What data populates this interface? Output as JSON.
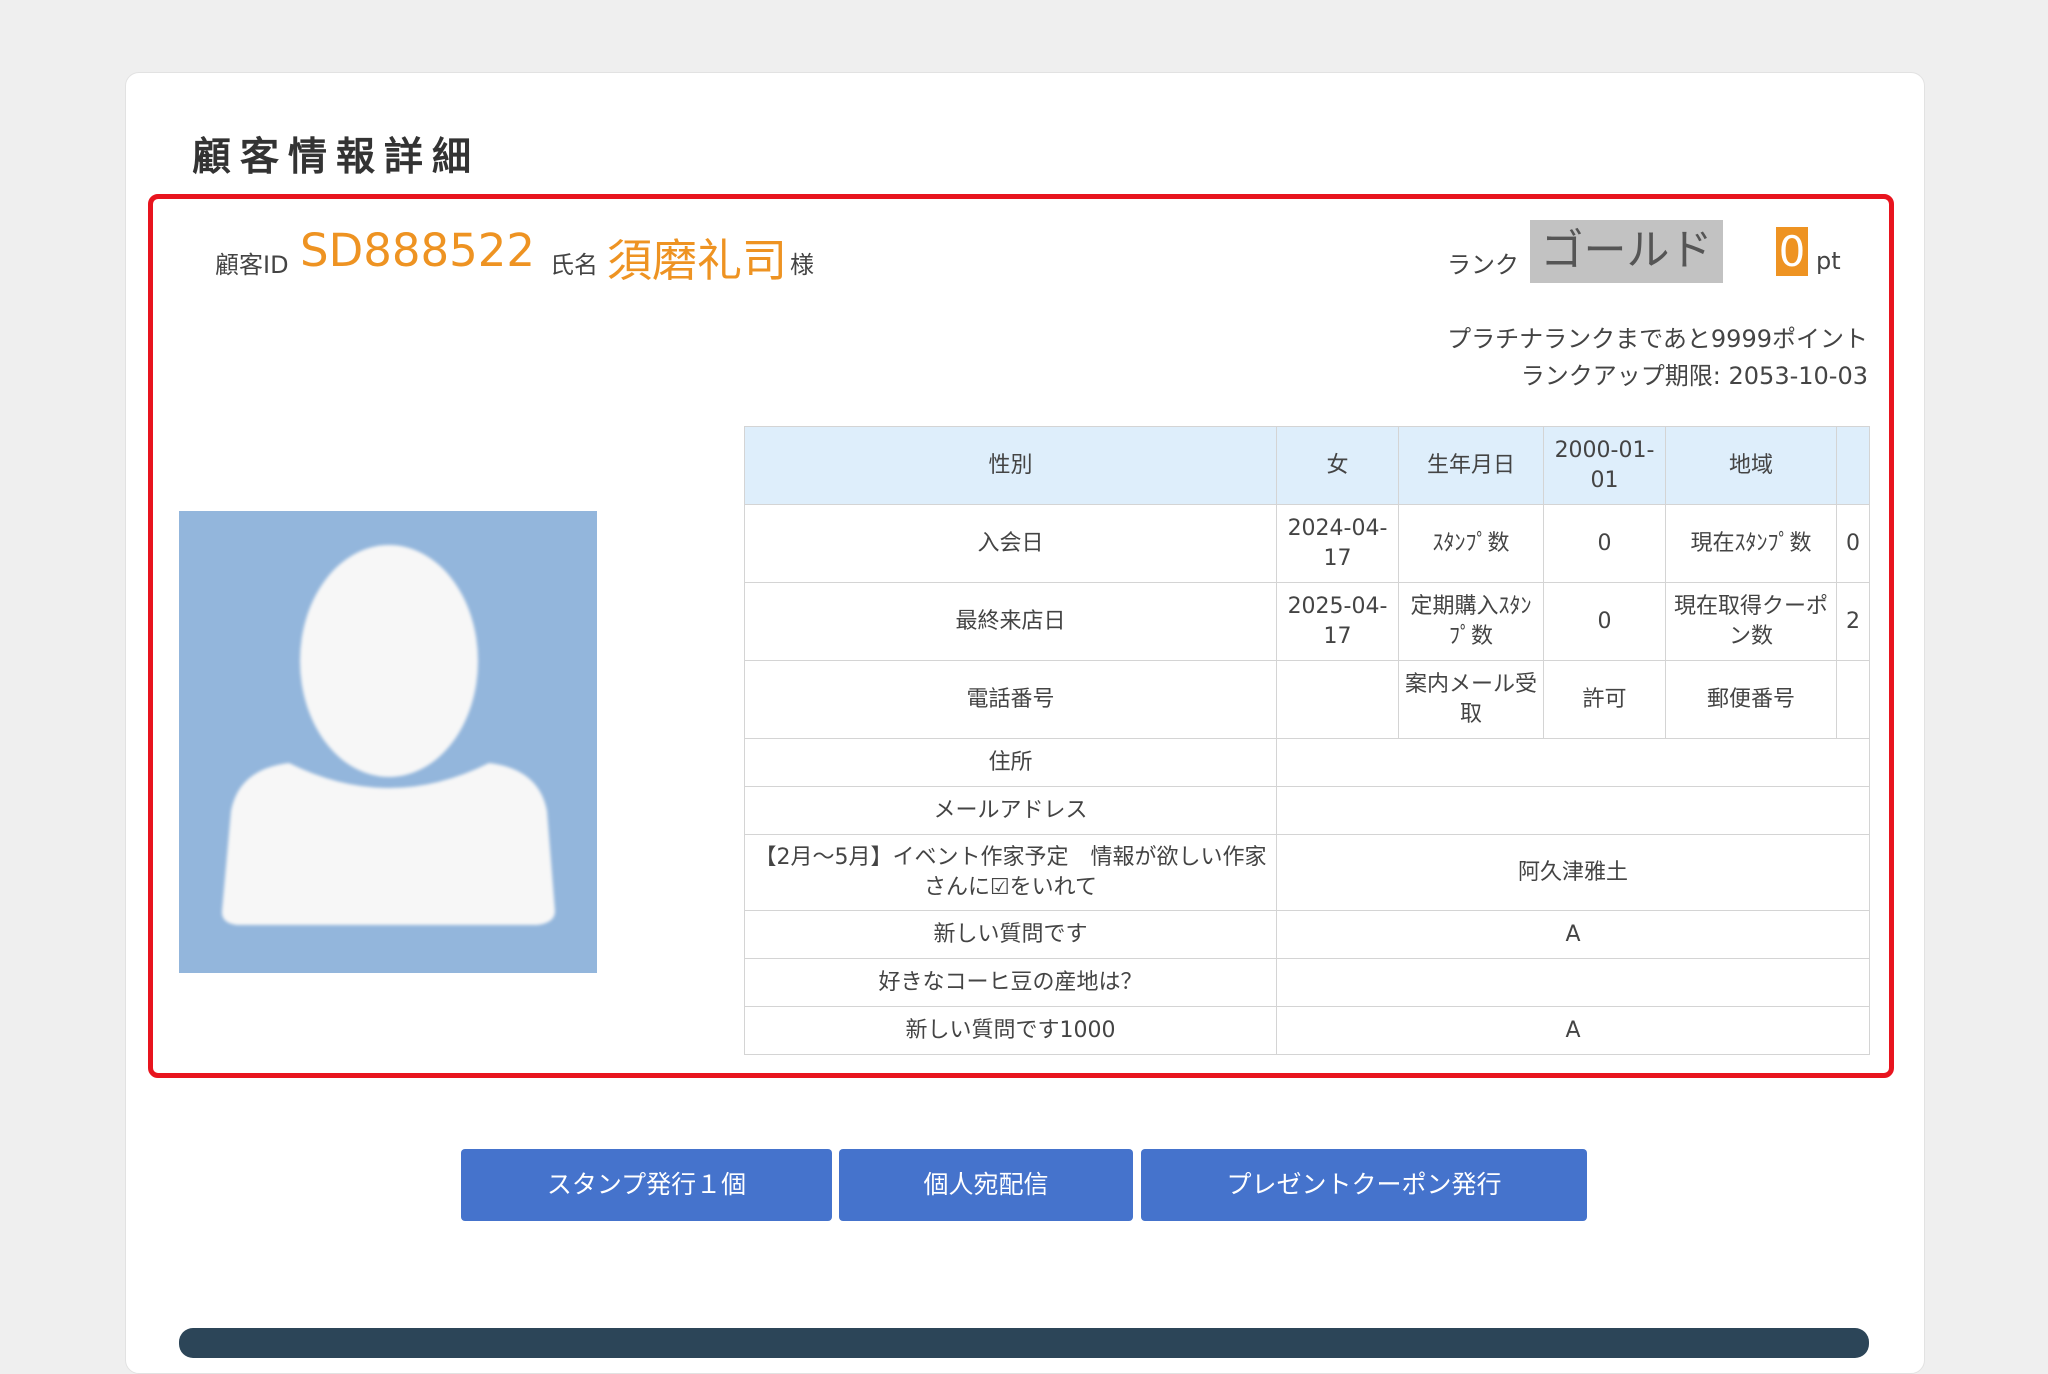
{
  "page": {
    "title": "顧客情報詳細"
  },
  "customer": {
    "id_label": "顧客ID",
    "id": "SD888522",
    "name_label": "氏名",
    "name": "須磨礼司",
    "honorific": "様",
    "rank_label": "ランク",
    "rank": "ゴールド",
    "points": "0",
    "points_unit": "pt",
    "next_rank_text": "プラチナランクまであと9999ポイント",
    "rank_deadline": "ランクアップ期限: 2053-10-03"
  },
  "table": {
    "grid": [
      [
        "性別",
        "女",
        "生年月日",
        "2000-01-01",
        "地域",
        ""
      ],
      [
        "入会日",
        "2024-04-17",
        "ｽﾀﾝﾌﾟ数",
        "0",
        "現在ｽﾀﾝﾌﾟ数",
        "0"
      ],
      [
        "最終来店日",
        "2025-04-17",
        "定期購入ｽﾀﾝﾌﾟ数",
        "0",
        "現在取得クーポン数",
        "2"
      ],
      [
        "電話番号",
        "",
        "案内メール受取",
        "許可",
        "郵便番号",
        ""
      ]
    ],
    "rows": [
      {
        "label": "住所",
        "value": ""
      },
      {
        "label": "メールアドレス",
        "value": ""
      },
      {
        "label": "【2月〜5月】イベント作家予定　情報が欲しい作家さんに☑をいれて",
        "value": "阿久津雅土"
      },
      {
        "label": "新しい質問です",
        "value": "A"
      },
      {
        "label": "好きなコーヒ豆の産地は？",
        "value": ""
      },
      {
        "label": "新しい質問です1000",
        "value": "A"
      }
    ]
  },
  "buttons": {
    "stamp": "スタンプ発行１個",
    "message": "個人宛配信",
    "coupon": "プレゼントクーポン発行"
  },
  "icons": {
    "avatar": "default-user-silhouette"
  },
  "colors": {
    "accent": "#ee9322",
    "button": "#4573cc",
    "frame": "#e8141e",
    "rank_badge": "#c2c2c2"
  }
}
